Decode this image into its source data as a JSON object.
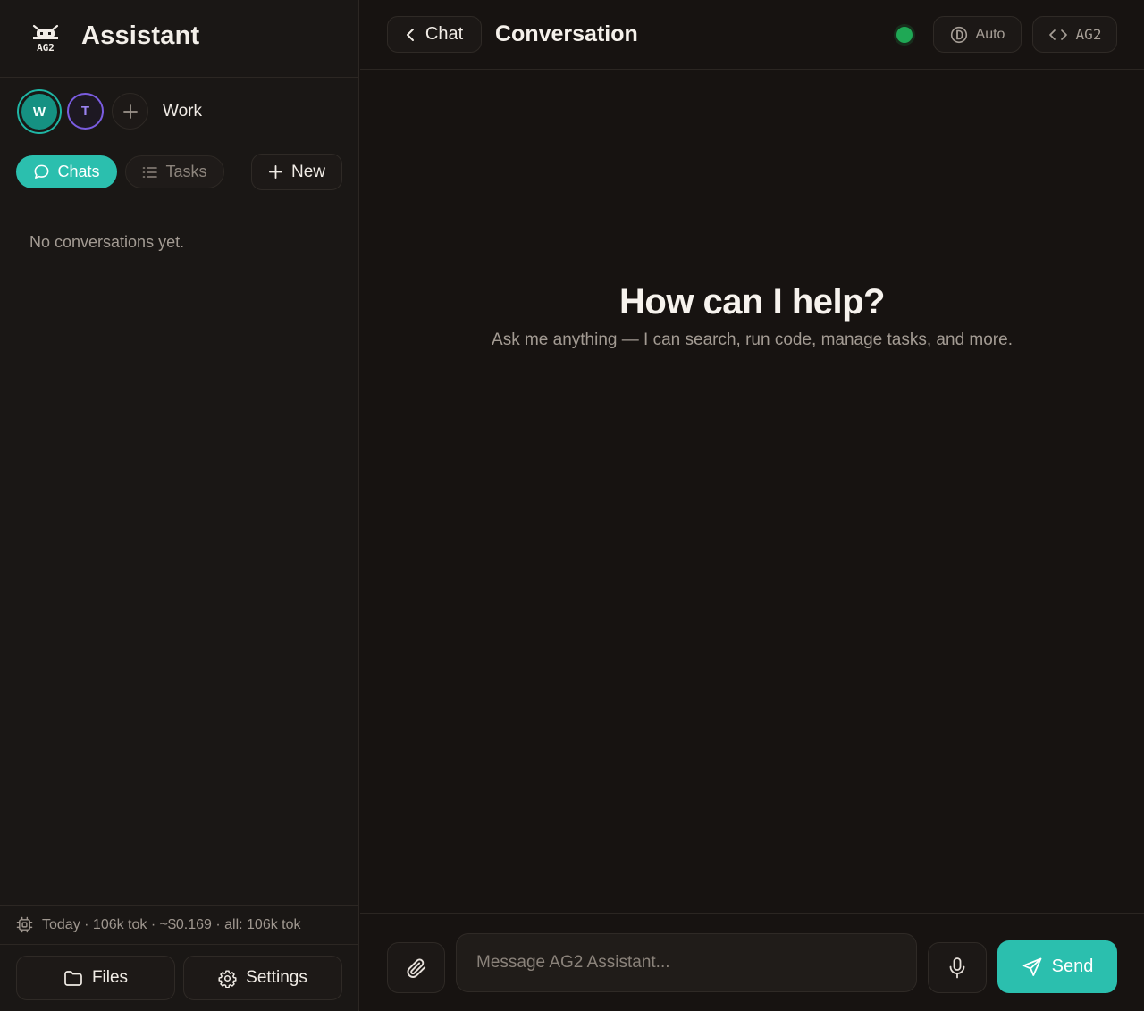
{
  "app": {
    "title": "Assistant",
    "logo_text": "AG2"
  },
  "workspaces": {
    "items": [
      {
        "initial": "W",
        "active": true
      },
      {
        "initial": "T",
        "active": false
      }
    ],
    "current_name": "Work"
  },
  "sidebar": {
    "tabs": [
      {
        "label": "Chats",
        "icon": "chat-bubble-icon",
        "active": true
      },
      {
        "label": "Tasks",
        "icon": "list-icon",
        "active": false
      }
    ],
    "new_label": "New",
    "empty_text": "No conversations yet.",
    "usage_text": "Today · 106k tok · ~$0.169 · all: 106k tok",
    "files_label": "Files",
    "settings_label": "Settings"
  },
  "header": {
    "back_label": "Chat",
    "title": "Conversation",
    "status": "online",
    "mode_label": "Auto",
    "agent_label": "AG2"
  },
  "hero": {
    "title": "How can I help?",
    "subtitle": "Ask me anything — I can search, run code, manage tasks, and more."
  },
  "composer": {
    "placeholder": "Message AG2 Assistant...",
    "value": "",
    "send_label": "Send"
  },
  "colors": {
    "accent": "#2bbfae",
    "background": "#171311",
    "sidebar": "#1a1715",
    "status_online": "#1fa855",
    "workspace_t": "#7a5ce0"
  }
}
